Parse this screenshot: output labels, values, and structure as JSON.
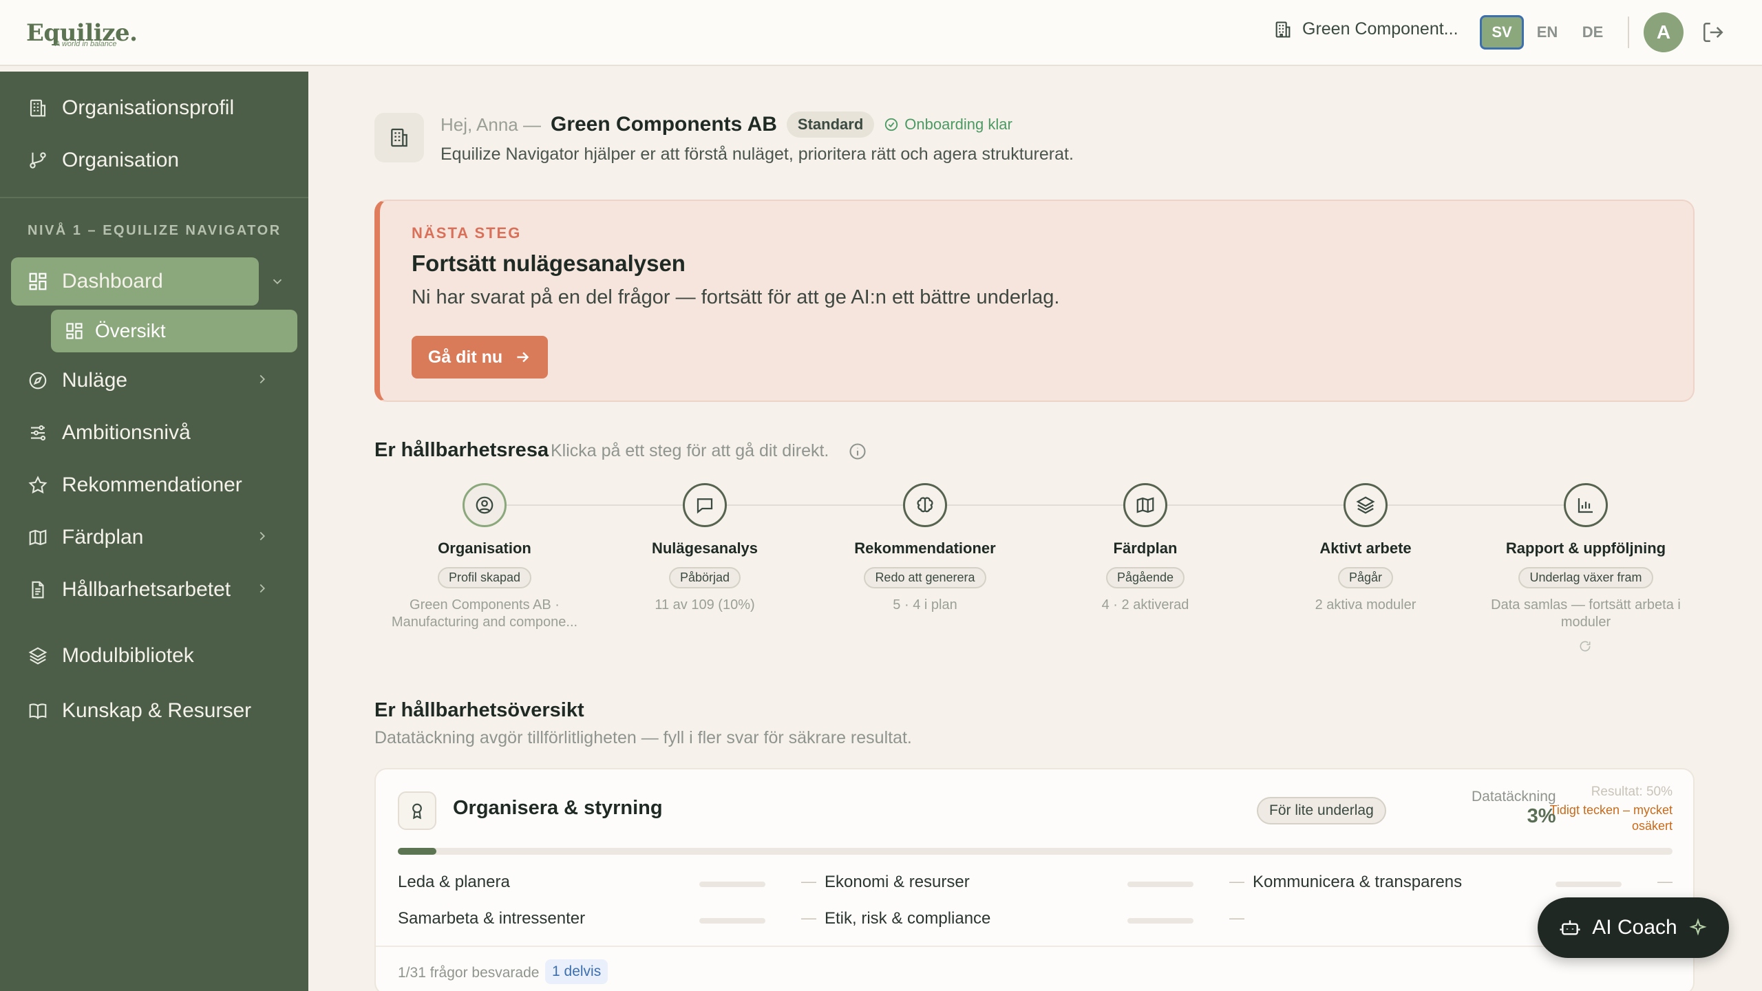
{
  "brand": {
    "name": "Equilize.",
    "tagline": "A world in balance"
  },
  "topbar": {
    "org_selector": "Green Component...",
    "languages": [
      "SV",
      "EN",
      "DE"
    ],
    "active_language": "SV",
    "avatar_initial": "A"
  },
  "sidebar": {
    "top_items": [
      {
        "label": "Organisationsprofil",
        "icon": "building-icon"
      },
      {
        "label": "Organisation",
        "icon": "branch-icon"
      }
    ],
    "section_label": "NIVÅ 1 – EQUILIZE NAVIGATOR",
    "items": [
      {
        "label": "Dashboard",
        "icon": "dashboard-icon",
        "expanded": true
      },
      {
        "label": "Översikt",
        "icon": "dashboard-icon"
      },
      {
        "label": "Nuläge",
        "icon": "compass-icon"
      },
      {
        "label": "Ambitionsnivå",
        "icon": "sliders-icon"
      },
      {
        "label": "Rekommendationer",
        "icon": "star-icon"
      },
      {
        "label": "Färdplan",
        "icon": "map-icon"
      },
      {
        "label": "Hållbarhetsarbetet",
        "icon": "document-icon"
      },
      {
        "label": "Modulbibliotek",
        "icon": "layers-icon"
      },
      {
        "label": "Kunskap & Resurser",
        "icon": "book-icon"
      }
    ]
  },
  "header": {
    "greeting": "Hej, Anna —",
    "org_name": "Green Components AB",
    "plan_badge": "Standard",
    "onboarding": "Onboarding klar",
    "subtitle": "Equilize Navigator hjälper er att förstå nuläget, prioritera rätt och agera strukturerat."
  },
  "next_step": {
    "eyebrow": "NÄSTA STEG",
    "title": "Fortsätt nulägesanalysen",
    "description": "Ni har svarat på en del frågor — fortsätt för att ge AI:n ett bättre underlag.",
    "button": "Gå dit nu"
  },
  "journey": {
    "title": "Er hållbarhetsresa",
    "hint": "Klicka på ett steg för att gå dit direkt.",
    "steps": [
      {
        "label": "Organisation",
        "status": "Profil skapad",
        "meta": "Green Components AB · Manufacturing and compone...",
        "icon": "user-circle-icon"
      },
      {
        "label": "Nulägesanalys",
        "status": "Påbörjad",
        "meta": "11 av 109 (10%)",
        "icon": "chat-icon"
      },
      {
        "label": "Rekommendationer",
        "status": "Redo att generera",
        "meta": "5 · 4 i plan",
        "icon": "brain-icon"
      },
      {
        "label": "Färdplan",
        "status": "Pågående",
        "meta": "4 · 2 aktiverad",
        "icon": "map-icon"
      },
      {
        "label": "Aktivt arbete",
        "status": "Pågår",
        "meta": "2 aktiva moduler",
        "icon": "layers-icon"
      },
      {
        "label": "Rapport & uppföljning",
        "status": "Underlag växer fram",
        "meta": "Data samlas — fortsätt arbeta i moduler",
        "icon": "bar-chart-icon"
      }
    ]
  },
  "overview": {
    "title": "Er hållbarhetsöversikt",
    "subtitle": "Datatäckning avgör tillförlitligheten — fyll i fler svar för säkrare resultat.",
    "card": {
      "title": "Organisera & styrning",
      "badge": "För lite underlag",
      "coverage_label": "Datatäckning",
      "coverage_value": "3%",
      "coverage_fraction": 0.03,
      "result_label": "Resultat: 50%",
      "result_note": "Tidigt tecken – mycket osäkert",
      "categories": [
        "Leda & planera",
        "Ekonomi & resurser",
        "Kommunicera & transparens",
        "Samarbeta & intressenter",
        "Etik, risk & compliance"
      ],
      "dash": "—",
      "answered": "1/31 frågor besvarade",
      "partial": "1 delvis"
    }
  },
  "ai_coach": {
    "label": "AI Coach"
  },
  "colors": {
    "sidebar": "#4c5e48",
    "accent": "#8ba77c",
    "cta": "#d97a59",
    "warning": "#c96a1a"
  }
}
